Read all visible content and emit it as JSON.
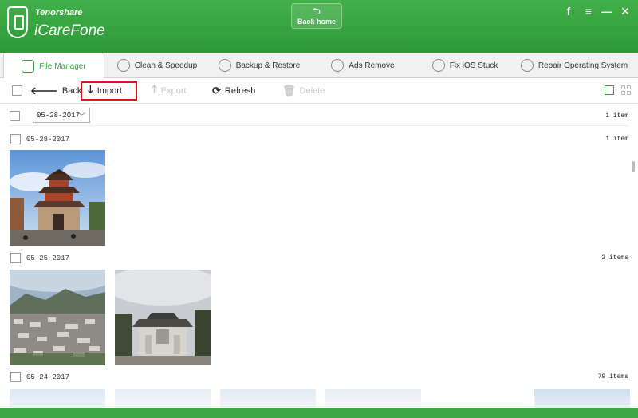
{
  "app": {
    "vendor": "Tenorshare",
    "name": "iCareFone",
    "back_home": "Back home",
    "controls": [
      "f",
      "≡",
      "—",
      "✕"
    ]
  },
  "tabs": [
    {
      "label": "File Manager",
      "icon": "file-manager-icon",
      "active": true
    },
    {
      "label": "Clean & Speedup",
      "icon": "rocket-icon",
      "active": false
    },
    {
      "label": "Backup & Restore",
      "icon": "folder-icon",
      "active": false
    },
    {
      "label": "Ads Remove",
      "icon": "ads-remove-icon",
      "active": false
    },
    {
      "label": "Fix iOS Stuck",
      "icon": "refresh-circle-icon",
      "active": false
    },
    {
      "label": "Repair Operating System",
      "icon": "wrench-icon",
      "active": false
    }
  ],
  "toolbar": {
    "back": "Back",
    "import": "Import",
    "export": "Export",
    "refresh": "Refresh",
    "delete": "Delete"
  },
  "filter": {
    "selected_date": "05-28-2017",
    "count": "1 item"
  },
  "groups": [
    {
      "date": "05-28-2017",
      "count": "1 item"
    },
    {
      "date": "05-25-2017",
      "count": "2 items"
    },
    {
      "date": "05-24-2017",
      "count": "79 items"
    }
  ],
  "colors": {
    "accent": "#3fa845",
    "highlight": "#e0121a"
  }
}
